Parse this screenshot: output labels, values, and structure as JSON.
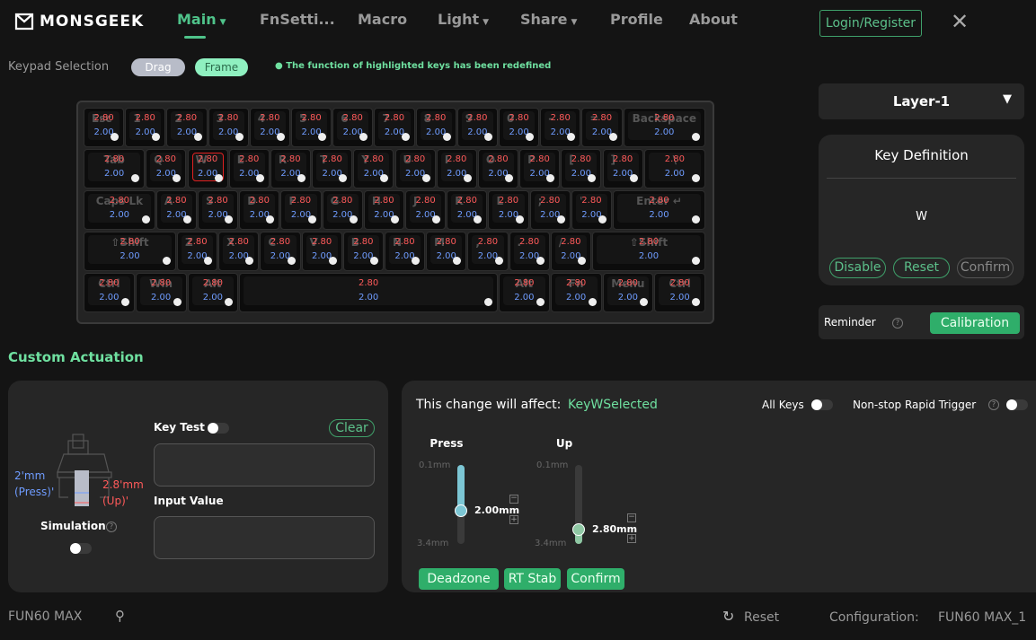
{
  "header": {
    "brand": "MONSGEEK",
    "nav": [
      {
        "label": "Main",
        "caret": true,
        "active": true
      },
      {
        "label": "FnSetti...",
        "caret": false
      },
      {
        "label": "Macro",
        "caret": false
      },
      {
        "label": "Light",
        "caret": true
      },
      {
        "label": "Share",
        "caret": true
      },
      {
        "label": "Profile",
        "caret": false
      },
      {
        "label": "About",
        "caret": false
      }
    ],
    "login": "Login/Register"
  },
  "selection": {
    "label": "Keypad Selection",
    "drag": "Drag",
    "frame": "Frame",
    "notice": "● The function of highlighted keys has been redefined"
  },
  "keyboard": {
    "up": "2.80",
    "press": "2.00",
    "selected": "W",
    "rows": [
      [
        [
          "Esc",
          1
        ],
        [
          "1",
          1
        ],
        [
          "2",
          1
        ],
        [
          "3",
          1
        ],
        [
          "4",
          1
        ],
        [
          "5",
          1
        ],
        [
          "6",
          1
        ],
        [
          "7",
          1
        ],
        [
          "8",
          1
        ],
        [
          "9",
          1
        ],
        [
          "0",
          1
        ],
        [
          "-",
          1
        ],
        [
          "=",
          1
        ],
        [
          "Backspace",
          2
        ]
      ],
      [
        [
          "Tab",
          1.5
        ],
        [
          "Q",
          1
        ],
        [
          "W",
          1
        ],
        [
          "E",
          1
        ],
        [
          "R",
          1
        ],
        [
          "T",
          1
        ],
        [
          "Y",
          1
        ],
        [
          "U",
          1
        ],
        [
          "I",
          1
        ],
        [
          "O",
          1
        ],
        [
          "P",
          1
        ],
        [
          "[",
          1
        ],
        [
          "]",
          1
        ],
        [
          "\\",
          1.5
        ]
      ],
      [
        [
          "Caps Lk",
          1.75
        ],
        [
          "A",
          1
        ],
        [
          "S",
          1
        ],
        [
          "D",
          1
        ],
        [
          "F",
          1
        ],
        [
          "G",
          1
        ],
        [
          "H",
          1
        ],
        [
          "J",
          1
        ],
        [
          "K",
          1
        ],
        [
          "L",
          1
        ],
        [
          ";",
          1
        ],
        [
          "'",
          1
        ],
        [
          "Enter ↵",
          2.25
        ]
      ],
      [
        [
          "⇧Shift",
          2.25
        ],
        [
          "Z",
          1
        ],
        [
          "X",
          1
        ],
        [
          "C",
          1
        ],
        [
          "V",
          1
        ],
        [
          "B",
          1
        ],
        [
          "N",
          1
        ],
        [
          "M",
          1
        ],
        [
          ",",
          1
        ],
        [
          ".",
          1
        ],
        [
          "/",
          1
        ],
        [
          "⇧Shift",
          2.75
        ]
      ],
      [
        [
          "Ctrl",
          1.25
        ],
        [
          "Win",
          1.25
        ],
        [
          "Alt",
          1.25
        ],
        [
          "",
          6.25
        ],
        [
          "Alt",
          1.25
        ],
        [
          "Fn",
          1.25
        ],
        [
          "Menu",
          1.25
        ],
        [
          "Ctrl",
          1.25
        ]
      ]
    ]
  },
  "layer": {
    "value": "Layer-1"
  },
  "keydef": {
    "title": "Key Definition",
    "key": "W",
    "disable": "Disable",
    "reset": "Reset",
    "confirm": "Confirm"
  },
  "reminder": {
    "label": "Reminder",
    "calibration": "Calibration"
  },
  "custom": {
    "title": "Custom Actuation",
    "press_mm": "2'mm",
    "press_lbl": "(Press)'",
    "up_mm": "2.8'mm",
    "up_lbl": "(Up)'",
    "simulation": "Simulation",
    "key_test": "Key Test",
    "clear": "Clear",
    "input_value": "Input Value"
  },
  "affect": {
    "label": "This change will affect:",
    "value": "KeyWSelected",
    "all_keys": "All Keys",
    "nonstop": "Non-stop Rapid Trigger"
  },
  "sliders": {
    "press": {
      "title": "Press",
      "min": "0.1mm",
      "max": "3.4mm",
      "value": "2.00mm",
      "level": 2.0
    },
    "up": {
      "title": "Up",
      "min": "0.1mm",
      "max": "3.4mm",
      "value": "2.80mm",
      "level": 2.8
    }
  },
  "actions": {
    "deadzone": "Deadzone",
    "rtstab": "RT Stab",
    "confirm": "Confirm"
  },
  "footer": {
    "device": "FUN60 MAX",
    "reset": "Reset",
    "config_label": "Configuration:",
    "config_value": "FUN60 MAX_1"
  },
  "colors": {
    "accent": "#4fc38a",
    "up": "#ff5a5a",
    "press": "#6f9cff"
  }
}
